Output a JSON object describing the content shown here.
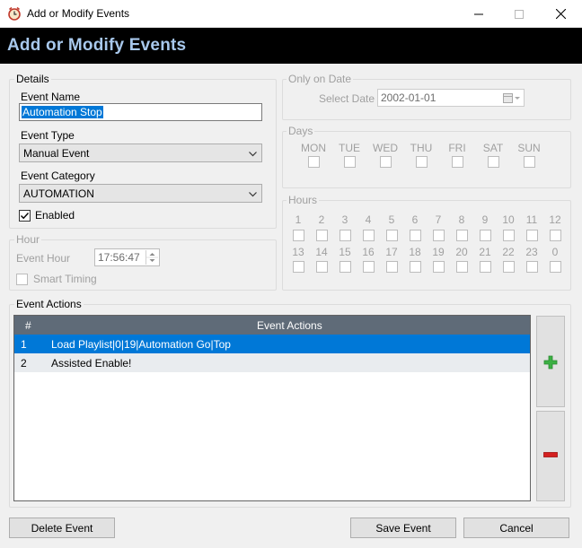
{
  "window": {
    "title": "Add or Modify Events",
    "icon": "alarm-clock-icon"
  },
  "banner": {
    "title": "Add or Modify Events"
  },
  "details": {
    "legend": "Details",
    "event_name_label": "Event Name",
    "event_name_value": "Automation Stop",
    "event_type_label": "Event Type",
    "event_type_value": "Manual Event",
    "event_category_label": "Event Category",
    "event_category_value": "AUTOMATION",
    "enabled_label": "Enabled",
    "enabled_checked": true
  },
  "only_on_date": {
    "legend": "Only on Date",
    "select_date_label": "Select Date",
    "date_value": "2002-01-01"
  },
  "days": {
    "legend": "Days",
    "items": [
      "MON",
      "TUE",
      "WED",
      "THU",
      "FRI",
      "SAT",
      "SUN"
    ]
  },
  "hours": {
    "legend": "Hours",
    "row1": [
      "1",
      "2",
      "3",
      "4",
      "5",
      "6",
      "7",
      "8",
      "9",
      "10",
      "11",
      "12"
    ],
    "row2": [
      "13",
      "14",
      "15",
      "16",
      "17",
      "18",
      "19",
      "20",
      "21",
      "22",
      "23",
      "0"
    ]
  },
  "hour": {
    "legend": "Hour",
    "event_hour_label": "Event Hour",
    "event_hour_value": "17:56:47",
    "smart_timing_label": "Smart Timing"
  },
  "event_actions": {
    "legend": "Event Actions",
    "columns": [
      "#",
      "Event Actions"
    ],
    "rows": [
      {
        "num": "1",
        "action": "Load Playlist|0|19|Automation Go|Top",
        "selected": true
      },
      {
        "num": "2",
        "action": "Assisted Enable!",
        "selected": false
      }
    ],
    "add_icon": "plus-icon",
    "remove_icon": "minus-icon"
  },
  "buttons": {
    "delete": "Delete Event",
    "save": "Save Event",
    "cancel": "Cancel"
  },
  "colors": {
    "banner_bg": "#000000",
    "banner_text": "#a8c8ec",
    "selection": "#0078d7",
    "grid_header": "#5f6b78",
    "add_green": "#3cb043",
    "remove_red": "#d42020"
  }
}
